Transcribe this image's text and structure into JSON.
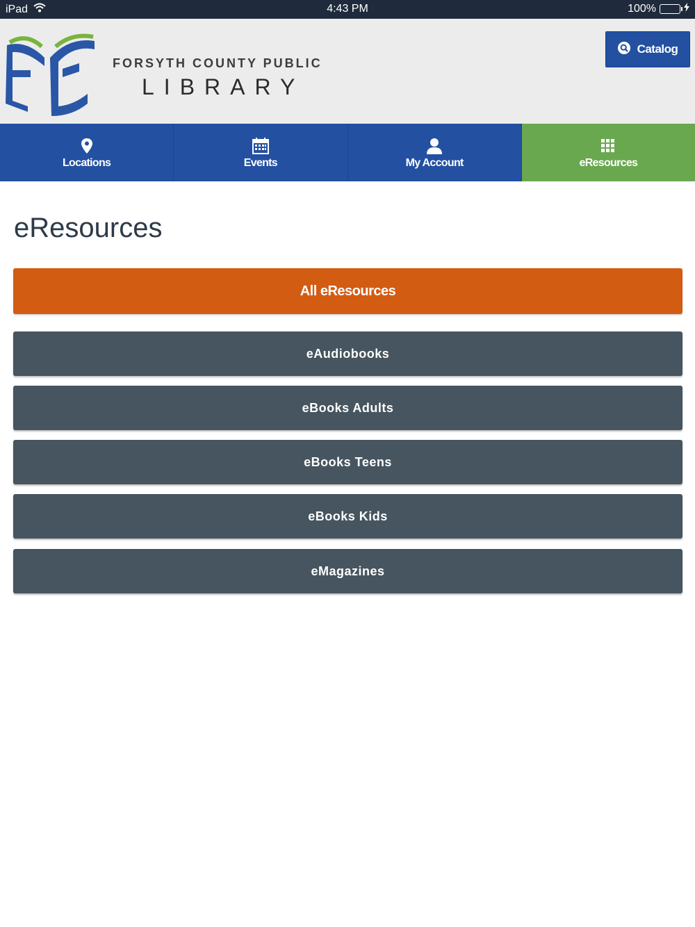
{
  "status_bar": {
    "device": "iPad",
    "time": "4:43 PM",
    "battery": "100%"
  },
  "header": {
    "brand_line1": "FORSYTH COUNTY PUBLIC",
    "brand_line2": "LIBRARY",
    "catalog_label": "Catalog",
    "colors": {
      "header_bg": "#ececec",
      "catalog_bg": "#2350a1"
    }
  },
  "nav": {
    "items": [
      {
        "label": "Locations",
        "icon": "map-pin-icon"
      },
      {
        "label": "Events",
        "icon": "calendar-icon"
      },
      {
        "label": "My Account",
        "icon": "user-icon"
      },
      {
        "label": "eResources",
        "icon": "grid-icon",
        "active": true
      }
    ],
    "colors": {
      "default": "#2350a1",
      "active": "#6aa84f"
    }
  },
  "main": {
    "title": "eResources",
    "primary_button": "All eResources",
    "buttons": [
      "eAudiobooks",
      "eBooks Adults",
      "eBooks Teens",
      "eBooks Kids",
      "eMagazines"
    ],
    "colors": {
      "primary": "#d35c13",
      "secondary": "#46555f"
    }
  }
}
